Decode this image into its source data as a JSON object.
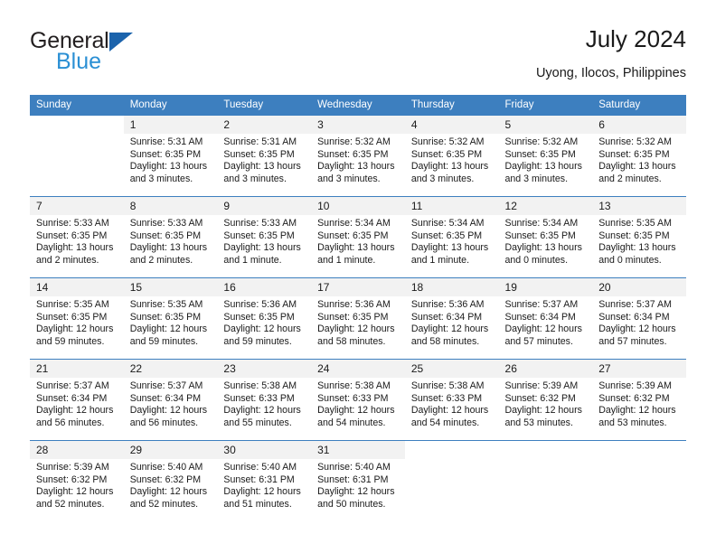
{
  "brand": {
    "name_part1": "General",
    "name_part2": "Blue",
    "mark": "triangle-icon"
  },
  "header": {
    "title": "July 2024",
    "subtitle": "Uyong, Ilocos, Philippines"
  },
  "calendar": {
    "weekday_headers": [
      "Sunday",
      "Monday",
      "Tuesday",
      "Wednesday",
      "Thursday",
      "Friday",
      "Saturday"
    ],
    "colors": {
      "header_background": "#3d7fbf",
      "header_text": "#ffffff",
      "daynum_background": "#f2f2f2",
      "row_separator": "#3d7fbf",
      "brand_dark": "#231f20",
      "brand_blue": "#2a8fd4",
      "text": "#1a1a1a"
    },
    "labels": {
      "sunrise": "Sunrise:",
      "sunset": "Sunset:",
      "daylight": "Daylight:"
    },
    "weeks": [
      [
        {
          "day": "",
          "sunrise": "",
          "sunset": "",
          "daylight_line1": "",
          "daylight_line2": ""
        },
        {
          "day": "1",
          "sunrise": "Sunrise: 5:31 AM",
          "sunset": "Sunset: 6:35 PM",
          "daylight_line1": "Daylight: 13 hours",
          "daylight_line2": "and 3 minutes."
        },
        {
          "day": "2",
          "sunrise": "Sunrise: 5:31 AM",
          "sunset": "Sunset: 6:35 PM",
          "daylight_line1": "Daylight: 13 hours",
          "daylight_line2": "and 3 minutes."
        },
        {
          "day": "3",
          "sunrise": "Sunrise: 5:32 AM",
          "sunset": "Sunset: 6:35 PM",
          "daylight_line1": "Daylight: 13 hours",
          "daylight_line2": "and 3 minutes."
        },
        {
          "day": "4",
          "sunrise": "Sunrise: 5:32 AM",
          "sunset": "Sunset: 6:35 PM",
          "daylight_line1": "Daylight: 13 hours",
          "daylight_line2": "and 3 minutes."
        },
        {
          "day": "5",
          "sunrise": "Sunrise: 5:32 AM",
          "sunset": "Sunset: 6:35 PM",
          "daylight_line1": "Daylight: 13 hours",
          "daylight_line2": "and 3 minutes."
        },
        {
          "day": "6",
          "sunrise": "Sunrise: 5:32 AM",
          "sunset": "Sunset: 6:35 PM",
          "daylight_line1": "Daylight: 13 hours",
          "daylight_line2": "and 2 minutes."
        }
      ],
      [
        {
          "day": "7",
          "sunrise": "Sunrise: 5:33 AM",
          "sunset": "Sunset: 6:35 PM",
          "daylight_line1": "Daylight: 13 hours",
          "daylight_line2": "and 2 minutes."
        },
        {
          "day": "8",
          "sunrise": "Sunrise: 5:33 AM",
          "sunset": "Sunset: 6:35 PM",
          "daylight_line1": "Daylight: 13 hours",
          "daylight_line2": "and 2 minutes."
        },
        {
          "day": "9",
          "sunrise": "Sunrise: 5:33 AM",
          "sunset": "Sunset: 6:35 PM",
          "daylight_line1": "Daylight: 13 hours",
          "daylight_line2": "and 1 minute."
        },
        {
          "day": "10",
          "sunrise": "Sunrise: 5:34 AM",
          "sunset": "Sunset: 6:35 PM",
          "daylight_line1": "Daylight: 13 hours",
          "daylight_line2": "and 1 minute."
        },
        {
          "day": "11",
          "sunrise": "Sunrise: 5:34 AM",
          "sunset": "Sunset: 6:35 PM",
          "daylight_line1": "Daylight: 13 hours",
          "daylight_line2": "and 1 minute."
        },
        {
          "day": "12",
          "sunrise": "Sunrise: 5:34 AM",
          "sunset": "Sunset: 6:35 PM",
          "daylight_line1": "Daylight: 13 hours",
          "daylight_line2": "and 0 minutes."
        },
        {
          "day": "13",
          "sunrise": "Sunrise: 5:35 AM",
          "sunset": "Sunset: 6:35 PM",
          "daylight_line1": "Daylight: 13 hours",
          "daylight_line2": "and 0 minutes."
        }
      ],
      [
        {
          "day": "14",
          "sunrise": "Sunrise: 5:35 AM",
          "sunset": "Sunset: 6:35 PM",
          "daylight_line1": "Daylight: 12 hours",
          "daylight_line2": "and 59 minutes."
        },
        {
          "day": "15",
          "sunrise": "Sunrise: 5:35 AM",
          "sunset": "Sunset: 6:35 PM",
          "daylight_line1": "Daylight: 12 hours",
          "daylight_line2": "and 59 minutes."
        },
        {
          "day": "16",
          "sunrise": "Sunrise: 5:36 AM",
          "sunset": "Sunset: 6:35 PM",
          "daylight_line1": "Daylight: 12 hours",
          "daylight_line2": "and 59 minutes."
        },
        {
          "day": "17",
          "sunrise": "Sunrise: 5:36 AM",
          "sunset": "Sunset: 6:35 PM",
          "daylight_line1": "Daylight: 12 hours",
          "daylight_line2": "and 58 minutes."
        },
        {
          "day": "18",
          "sunrise": "Sunrise: 5:36 AM",
          "sunset": "Sunset: 6:34 PM",
          "daylight_line1": "Daylight: 12 hours",
          "daylight_line2": "and 58 minutes."
        },
        {
          "day": "19",
          "sunrise": "Sunrise: 5:37 AM",
          "sunset": "Sunset: 6:34 PM",
          "daylight_line1": "Daylight: 12 hours",
          "daylight_line2": "and 57 minutes."
        },
        {
          "day": "20",
          "sunrise": "Sunrise: 5:37 AM",
          "sunset": "Sunset: 6:34 PM",
          "daylight_line1": "Daylight: 12 hours",
          "daylight_line2": "and 57 minutes."
        }
      ],
      [
        {
          "day": "21",
          "sunrise": "Sunrise: 5:37 AM",
          "sunset": "Sunset: 6:34 PM",
          "daylight_line1": "Daylight: 12 hours",
          "daylight_line2": "and 56 minutes."
        },
        {
          "day": "22",
          "sunrise": "Sunrise: 5:37 AM",
          "sunset": "Sunset: 6:34 PM",
          "daylight_line1": "Daylight: 12 hours",
          "daylight_line2": "and 56 minutes."
        },
        {
          "day": "23",
          "sunrise": "Sunrise: 5:38 AM",
          "sunset": "Sunset: 6:33 PM",
          "daylight_line1": "Daylight: 12 hours",
          "daylight_line2": "and 55 minutes."
        },
        {
          "day": "24",
          "sunrise": "Sunrise: 5:38 AM",
          "sunset": "Sunset: 6:33 PM",
          "daylight_line1": "Daylight: 12 hours",
          "daylight_line2": "and 54 minutes."
        },
        {
          "day": "25",
          "sunrise": "Sunrise: 5:38 AM",
          "sunset": "Sunset: 6:33 PM",
          "daylight_line1": "Daylight: 12 hours",
          "daylight_line2": "and 54 minutes."
        },
        {
          "day": "26",
          "sunrise": "Sunrise: 5:39 AM",
          "sunset": "Sunset: 6:32 PM",
          "daylight_line1": "Daylight: 12 hours",
          "daylight_line2": "and 53 minutes."
        },
        {
          "day": "27",
          "sunrise": "Sunrise: 5:39 AM",
          "sunset": "Sunset: 6:32 PM",
          "daylight_line1": "Daylight: 12 hours",
          "daylight_line2": "and 53 minutes."
        }
      ],
      [
        {
          "day": "28",
          "sunrise": "Sunrise: 5:39 AM",
          "sunset": "Sunset: 6:32 PM",
          "daylight_line1": "Daylight: 12 hours",
          "daylight_line2": "and 52 minutes."
        },
        {
          "day": "29",
          "sunrise": "Sunrise: 5:40 AM",
          "sunset": "Sunset: 6:32 PM",
          "daylight_line1": "Daylight: 12 hours",
          "daylight_line2": "and 52 minutes."
        },
        {
          "day": "30",
          "sunrise": "Sunrise: 5:40 AM",
          "sunset": "Sunset: 6:31 PM",
          "daylight_line1": "Daylight: 12 hours",
          "daylight_line2": "and 51 minutes."
        },
        {
          "day": "31",
          "sunrise": "Sunrise: 5:40 AM",
          "sunset": "Sunset: 6:31 PM",
          "daylight_line1": "Daylight: 12 hours",
          "daylight_line2": "and 50 minutes."
        },
        {
          "day": "",
          "sunrise": "",
          "sunset": "",
          "daylight_line1": "",
          "daylight_line2": ""
        },
        {
          "day": "",
          "sunrise": "",
          "sunset": "",
          "daylight_line1": "",
          "daylight_line2": ""
        },
        {
          "day": "",
          "sunrise": "",
          "sunset": "",
          "daylight_line1": "",
          "daylight_line2": ""
        }
      ]
    ]
  }
}
